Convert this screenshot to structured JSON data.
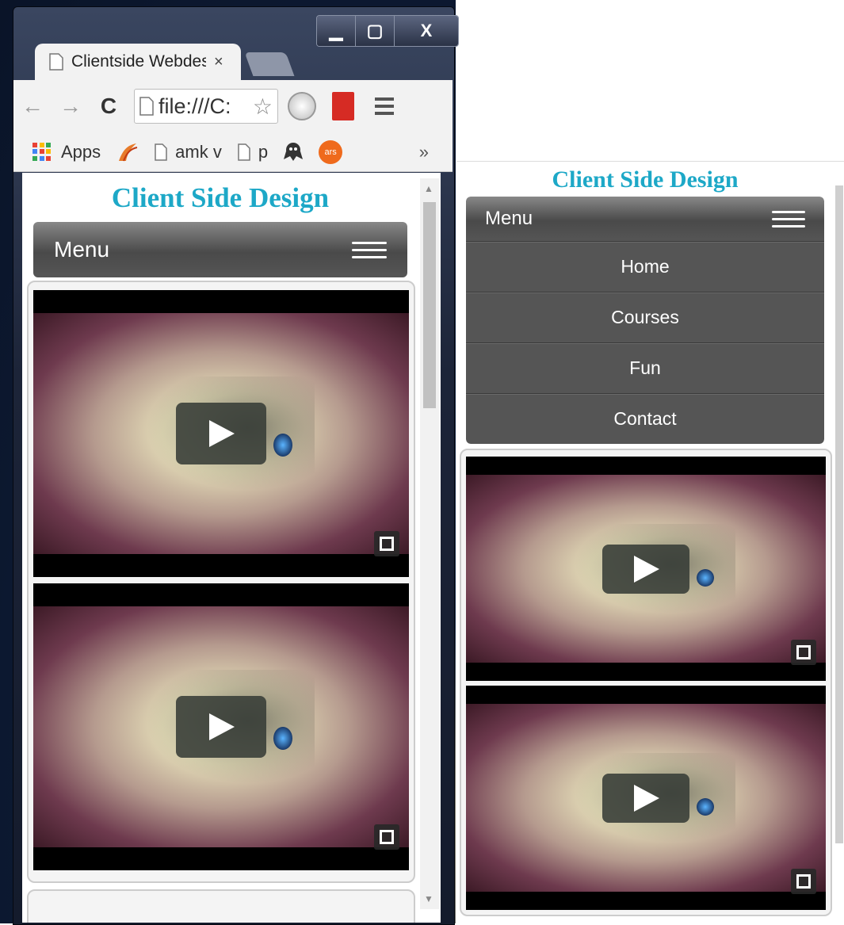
{
  "window": {
    "minimize_label": "▁",
    "maximize_label": "▢",
    "close_label": "X"
  },
  "tab": {
    "title": "Clientside Webdes",
    "close_label": "×"
  },
  "toolbar": {
    "back_icon": "←",
    "forward_icon": "→",
    "reload_icon": "C",
    "address": "file:///C:",
    "star_icon": "☆"
  },
  "bookmarks": {
    "apps_label": "Apps",
    "item1": "amk v",
    "item2": "p",
    "ars_label": "ars",
    "overflow": "»"
  },
  "page": {
    "site_title": "Client Side Design",
    "menu_label": "Menu",
    "nav_items": [
      "Home",
      "Courses",
      "Fun",
      "Contact"
    ]
  },
  "colors": {
    "title": "#1da8c7",
    "menubar": "#555555",
    "ars": "#ef6a1c"
  }
}
